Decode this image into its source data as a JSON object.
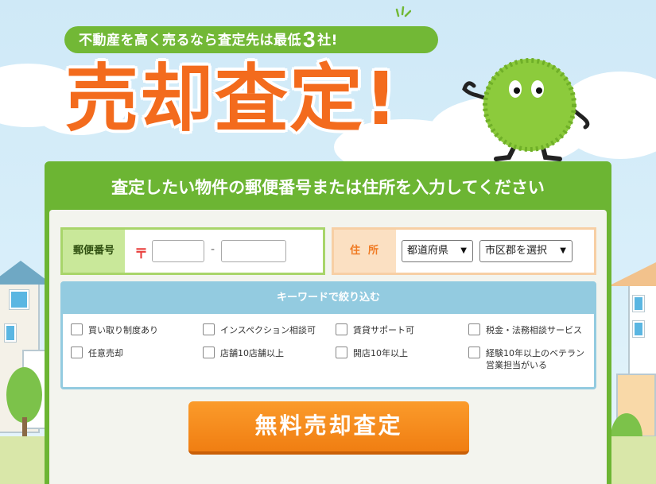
{
  "header": {
    "tagline_pre": "不動産を高く売るなら査定先は最低",
    "tagline_num": "3",
    "tagline_post": "社!",
    "headline": "売却査定!"
  },
  "form": {
    "title": "査定したい物件の郵便番号または住所を入力してください",
    "zip": {
      "label": "郵便番号",
      "mark": "〒",
      "first_value": "",
      "second_value": "",
      "dash": "-"
    },
    "address": {
      "label": "住所",
      "prefecture_selected": "都道府県",
      "city_selected": "市区郡を選択"
    },
    "keywords": {
      "title": "キーワードで絞り込む",
      "options": [
        "買い取り制度あり",
        "インスペクション相談可",
        "賃貸サポート可",
        "税金・法務相談サービス",
        "任意売却",
        "店舗10店舗以上",
        "開店10年以上",
        "経験10年以上のベテラン営業担当がいる"
      ]
    },
    "submit_label": "無料売却査定"
  },
  "colors": {
    "brand_green": "#6cb533",
    "accent_orange": "#f36b1d",
    "button_orange": "#f58a1f",
    "keyword_blue": "#93cbe0"
  }
}
